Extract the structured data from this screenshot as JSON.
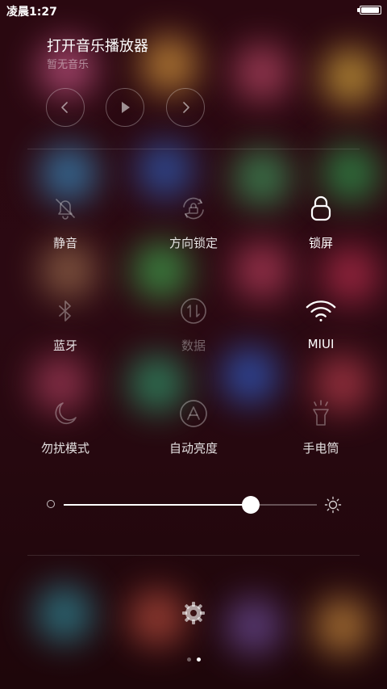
{
  "status_bar": {
    "time": "凌晨1:27",
    "battery_level": 0.95
  },
  "music": {
    "title": "打开音乐播放器",
    "subtitle": "暂无音乐",
    "controls": [
      {
        "icon": "chevron-left-icon",
        "name": "previous-track-button"
      },
      {
        "icon": "play-icon",
        "name": "play-button"
      },
      {
        "icon": "chevron-right-icon",
        "name": "next-track-button"
      }
    ]
  },
  "toggles": [
    {
      "id": "mute",
      "label": "静音",
      "icon": "bell-off-icon",
      "state": "off"
    },
    {
      "id": "rotation-lock",
      "label": "方向锁定",
      "icon": "rotation-lock-icon",
      "state": "off"
    },
    {
      "id": "lock-screen",
      "label": "锁屏",
      "icon": "padlock-icon",
      "state": "on"
    },
    {
      "id": "bluetooth",
      "label": "蓝牙",
      "icon": "bluetooth-icon",
      "state": "off"
    },
    {
      "id": "mobile-data",
      "label": "数据",
      "icon": "data-arrows-icon",
      "state": "disabled"
    },
    {
      "id": "wifi",
      "label": "MIUI",
      "icon": "wifi-icon",
      "state": "on"
    },
    {
      "id": "do-not-disturb",
      "label": "勿扰模式",
      "icon": "moon-icon",
      "state": "off"
    },
    {
      "id": "auto-brightness",
      "label": "自动亮度",
      "icon": "auto-brightness-icon",
      "state": "off"
    },
    {
      "id": "flashlight",
      "label": "手电筒",
      "icon": "flashlight-icon",
      "state": "off"
    }
  ],
  "brightness": {
    "level": 0.74
  },
  "pager": {
    "count": 2,
    "active": 1
  },
  "colors": {
    "background": "#23060c",
    "active_icon": "#ffffff",
    "inactive_icon": "#ffffff59",
    "disabled_label": "#ffffff59"
  },
  "background_blobs": [
    {
      "color": "#d05a8c"
    },
    {
      "color": "#e0a040"
    },
    {
      "color": "#c04a6a"
    },
    {
      "color": "#e0b040"
    },
    {
      "color": "#3a90c8"
    },
    {
      "color": "#3060c0"
    },
    {
      "color": "#40a060"
    },
    {
      "color": "#30a050"
    },
    {
      "color": "#a07050"
    },
    {
      "color": "#40b050"
    },
    {
      "color": "#c04060"
    },
    {
      "color": "#c03050"
    },
    {
      "color": "#b04060"
    },
    {
      "color": "#30a070"
    },
    {
      "color": "#3060d0"
    },
    {
      "color": "#c04050"
    },
    {
      "color": "#3090a0"
    },
    {
      "color": "#c05040"
    },
    {
      "color": "#7050a0"
    },
    {
      "color": "#d09040"
    }
  ]
}
